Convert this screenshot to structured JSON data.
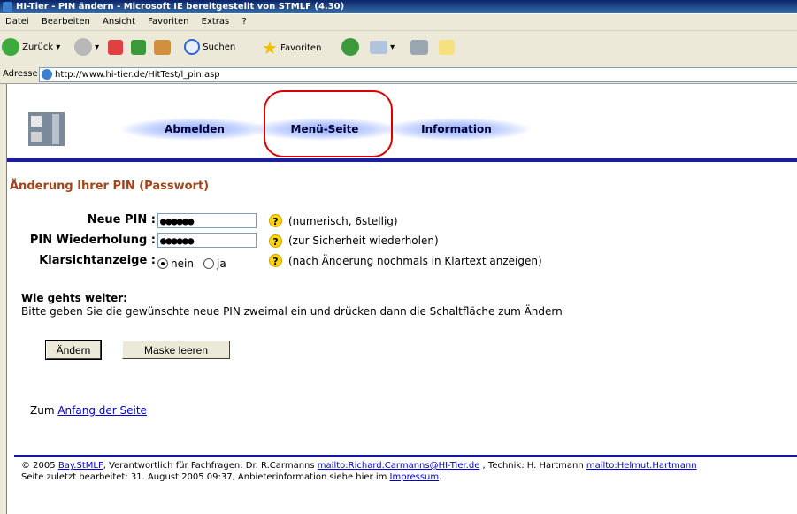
{
  "window": {
    "title": "HI-Tier - PIN ändern - Microsoft IE bereitgestellt von STMLF (4.30)"
  },
  "menu": [
    "Datei",
    "Bearbeiten",
    "Ansicht",
    "Favoriten",
    "Extras",
    "?"
  ],
  "toolbar": {
    "back": "Zurück",
    "search": "Suchen",
    "favorites": "Favoriten"
  },
  "address": {
    "label": "Adresse",
    "url": "http://www.hi-tier.de/HitTest/l_pin.asp"
  },
  "nav": {
    "logout": "Abmelden",
    "menu_page": "Menü-Seite",
    "info": "Information"
  },
  "page": {
    "heading": "Änderung Ihrer PIN (Passwort)",
    "fields": {
      "new_pin_label": "Neue PIN :",
      "new_pin_value": "●●●●●●",
      "new_pin_hint": "(numerisch, 6stellig)",
      "repeat_label": "PIN Wiederholung :",
      "repeat_value": "●●●●●●",
      "repeat_hint": "(zur Sicherheit wiederholen)",
      "plain_label": "Klarsichtanzeige :",
      "opt_no": "nein",
      "opt_yes": "ja",
      "plain_hint": "(nach Änderung nochmals in Klartext anzeigen)",
      "help": "?"
    },
    "next_heading": "Wie gehts weiter:",
    "next_text": "Bitte geben Sie die gewünschte neue PIN zweimal ein und drücken dann die Schaltfläche zum Ändern",
    "btn_change": "Ändern",
    "btn_clear": "Maske leeren",
    "top_prefix": "Zum",
    "top_link": "Anfang der Seite"
  },
  "footer": {
    "copyright": "© 2005",
    "org_link": "Bay.StMLF",
    "text1": ", Verantwortlich für Fachfragen: Dr. R.Carmanns",
    "mail1": "mailto:Richard.Carmanns@HI-Tier.de",
    "text2": ", Technik: H. Hartmann",
    "mail2": "mailto:Helmut.Hartmann",
    "line2": "Seite zuletzt bearbeitet: 31. August 2005 09:37, Anbieterinformation siehe hier im",
    "impressum": "Impressum",
    "line2_end": "."
  },
  "colors": {
    "heading": "#a0441a",
    "rule": "#1a1ab0",
    "highlight": "#d80000"
  }
}
